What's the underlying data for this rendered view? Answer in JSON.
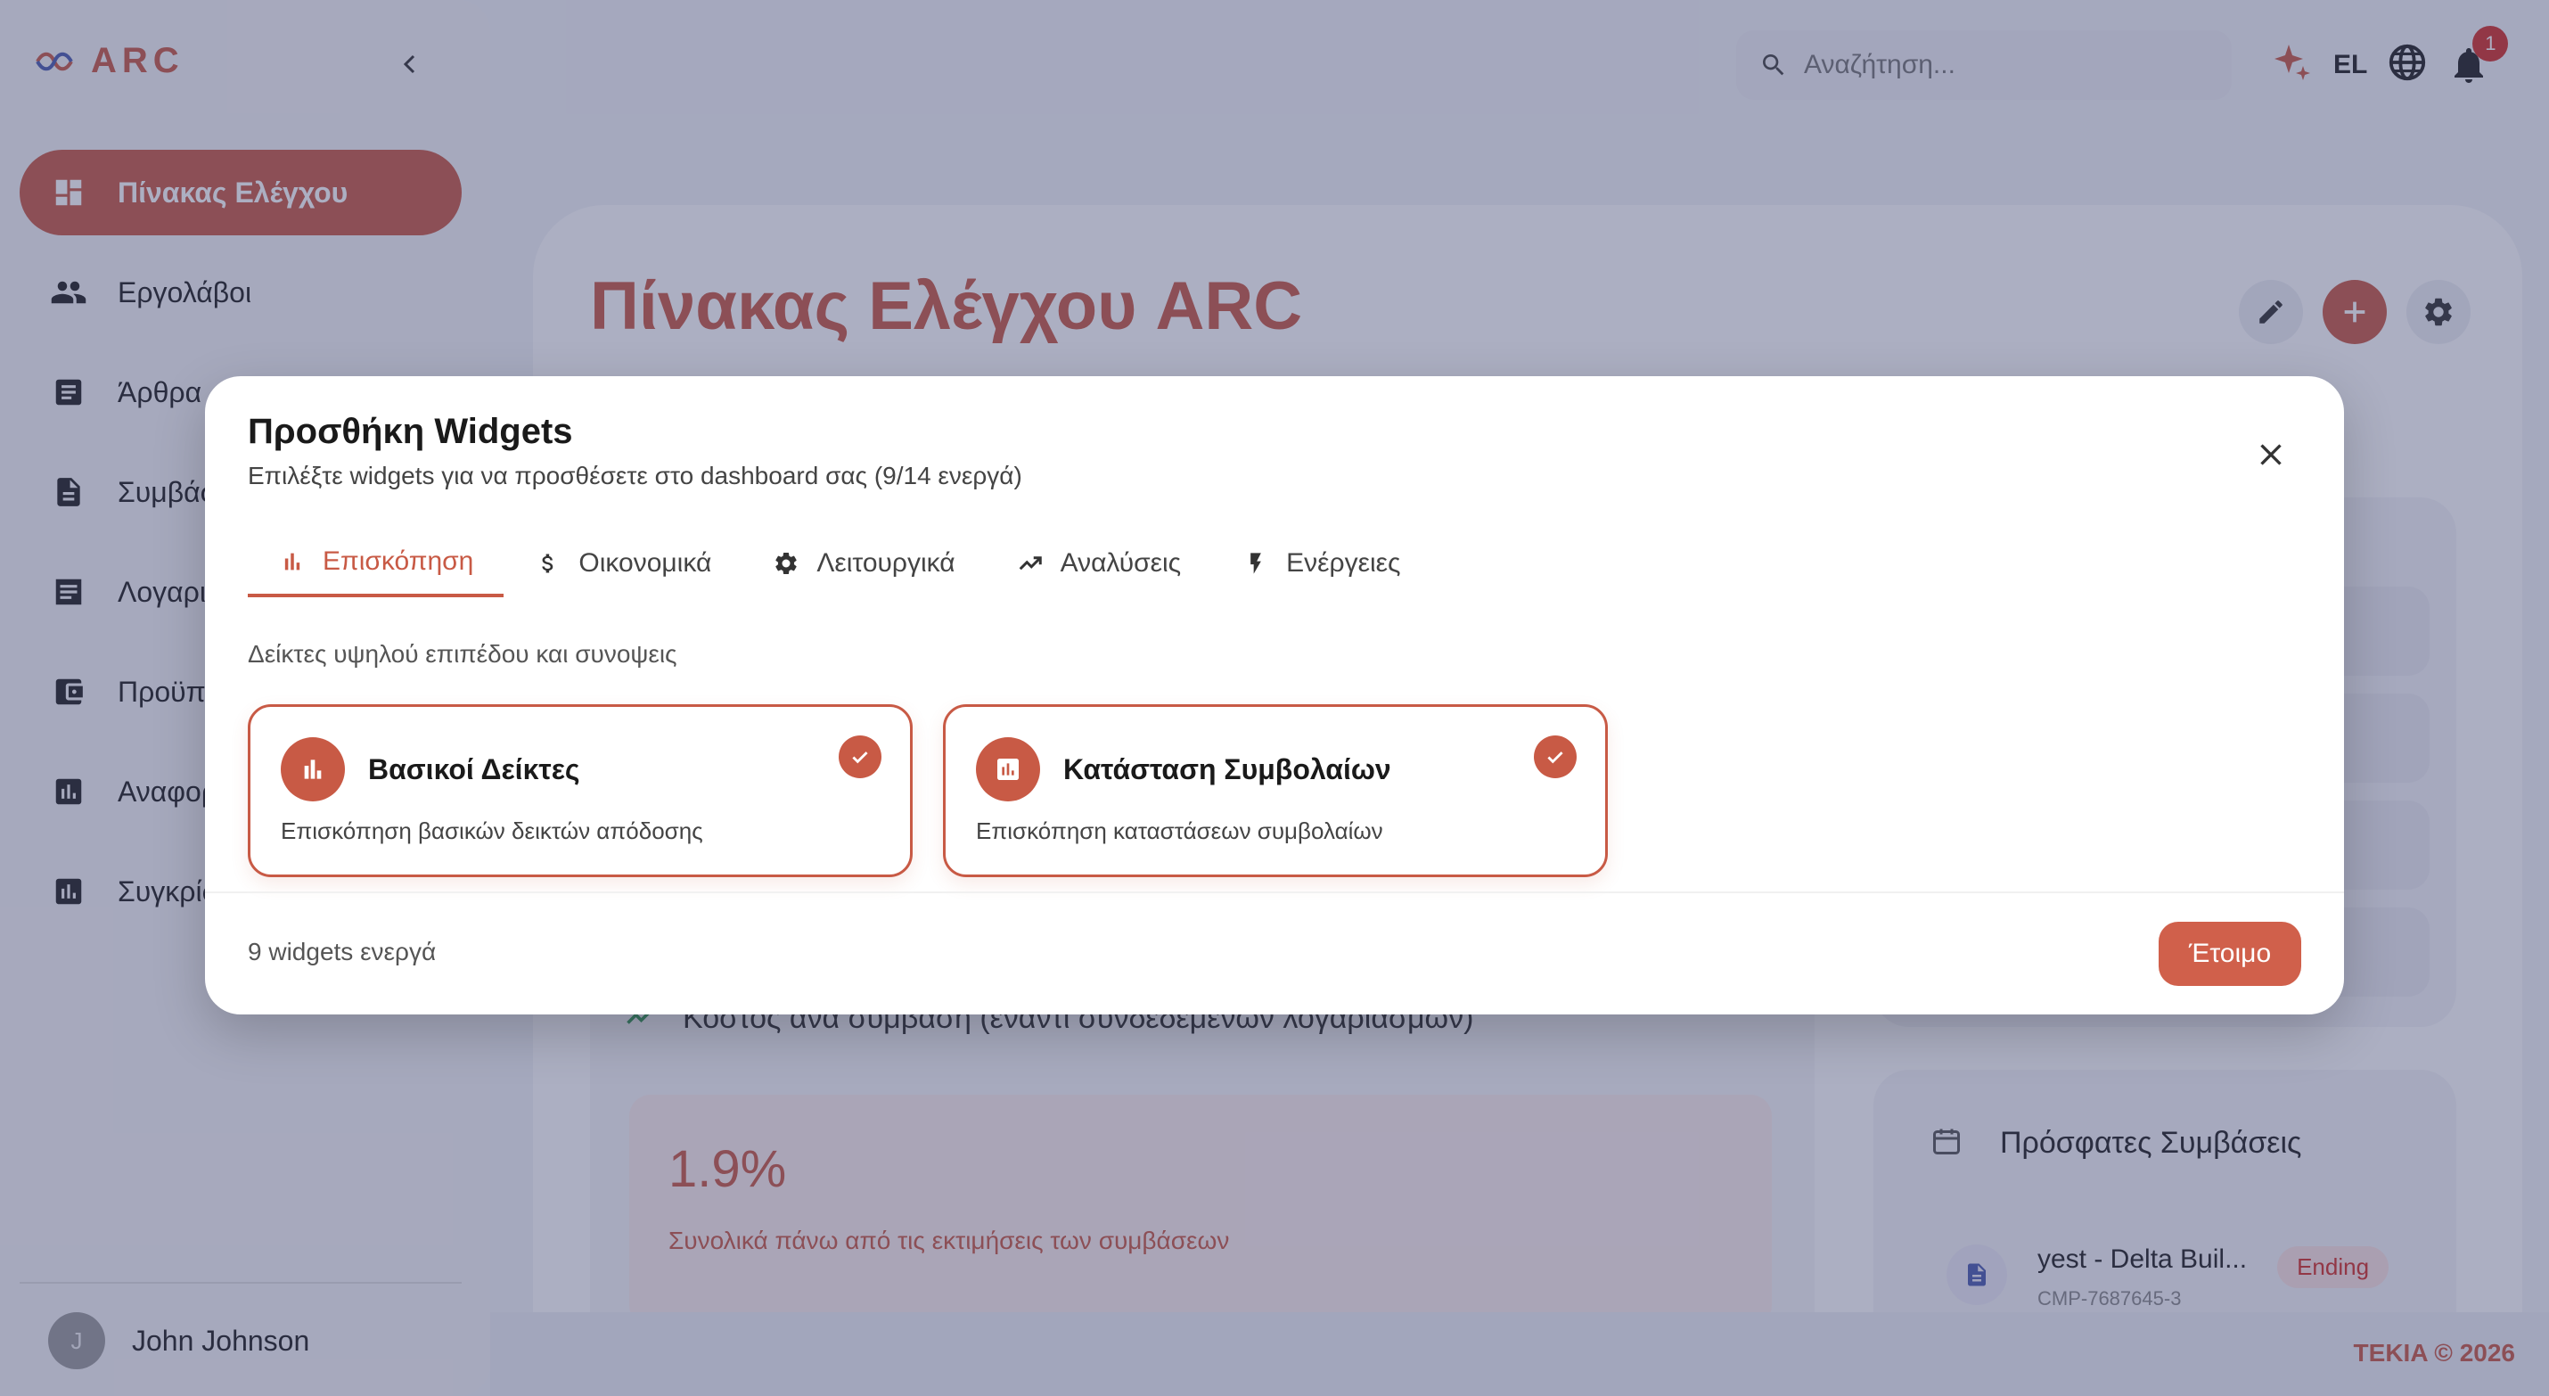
{
  "colors": {
    "accent": "#c85a45",
    "overlay": "rgba(58,64,110,0.42)",
    "badge": "#d3312a"
  },
  "brand": {
    "name": "ARC",
    "logo_icon": "infinity-wave-icon"
  },
  "sidebar": {
    "items": [
      {
        "label": "Πίνακας Ελέγχου",
        "icon": "dashboard-icon",
        "active": true
      },
      {
        "label": "Εργολάβοι",
        "icon": "people-icon"
      },
      {
        "label": "Άρθρα",
        "icon": "article-icon"
      },
      {
        "label": "Συμβάσεις",
        "icon": "document-icon"
      },
      {
        "label": "Λογαριασμοί",
        "icon": "receipt-icon"
      },
      {
        "label": "Προϋπολογισμοί",
        "icon": "wallet-icon"
      },
      {
        "label": "Αναφορές",
        "icon": "bar-chart-icon"
      },
      {
        "label": "Συγκρίσεις",
        "icon": "bar-chart-icon"
      }
    ],
    "user": {
      "initial": "J",
      "name": "John Johnson"
    }
  },
  "topbar": {
    "search_placeholder": "Αναζήτηση...",
    "language": "EL",
    "notifications_count": "1"
  },
  "page": {
    "title": "Πίνακας Ελέγχου ARC",
    "cost_widget": {
      "title": "Κόστος ανά σύμβαση (έναντι συνδεδεμένων λογαριασμών)",
      "value": "1.9%",
      "subtitle": "Συνολικά πάνω από τις εκτιμήσεις των συμβάσεων"
    },
    "recent": {
      "title": "Πρόσφατες Συμβάσεις",
      "item_name": "yest - Delta Buil...",
      "item_code": "CMP-7687645-3",
      "item_status": "Ending"
    },
    "footer": "TEKIA © 2026"
  },
  "modal": {
    "title": "Προσθήκη Widgets",
    "subtitle": "Επιλέξτε widgets για να προσθέσετε στο dashboard σας (9/14 ενεργά)",
    "tabs": [
      {
        "label": "Επισκόπηση",
        "icon": "bar-chart-icon",
        "active": true
      },
      {
        "label": "Οικονομικά",
        "icon": "dollar-icon"
      },
      {
        "label": "Λειτουργικά",
        "icon": "gear-icon"
      },
      {
        "label": "Αναλύσεις",
        "icon": "trending-up-icon"
      },
      {
        "label": "Ενέργειες",
        "icon": "bolt-icon"
      }
    ],
    "section_description": "Δείκτες υψηλού επιπέδου και συνοψεις",
    "widgets": [
      {
        "title": "Βασικοί Δείκτες",
        "description": "Επισκόπηση βασικών δεικτών απόδοσης",
        "selected": true,
        "icon": "bar-chart-icon"
      },
      {
        "title": "Κατάσταση Συμβολαίων",
        "description": "Επισκόπηση καταστάσεων συμβολαίων",
        "selected": true,
        "icon": "chart-box-icon"
      }
    ],
    "active_count": "9 widgets ενεργά",
    "done_label": "Έτοιμο"
  }
}
